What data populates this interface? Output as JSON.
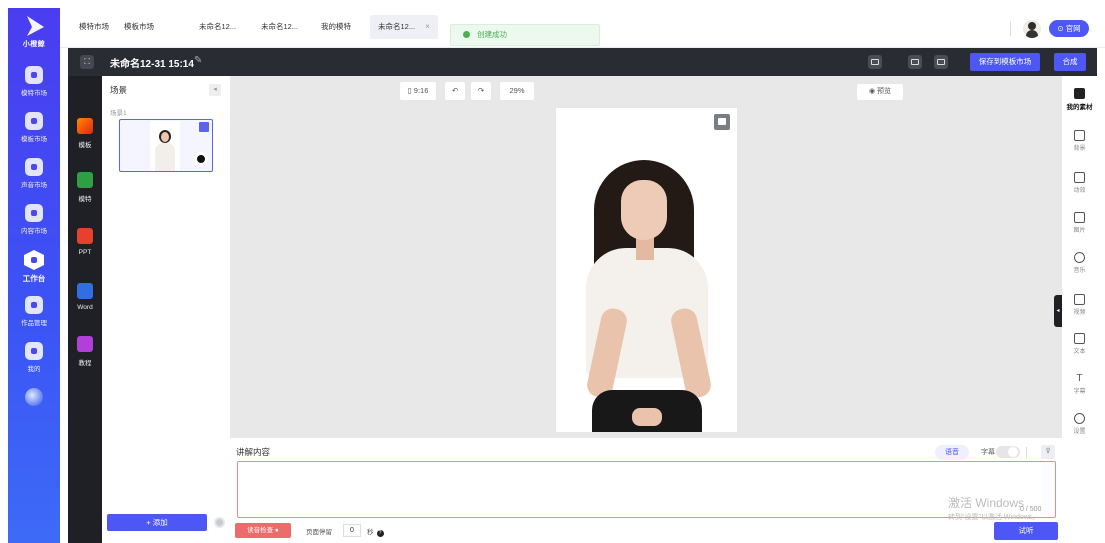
{
  "rail": {
    "logo": "小橙鲸",
    "items": [
      {
        "label": "模特市场",
        "icon": "model-market-icon"
      },
      {
        "label": "模板市场",
        "icon": "template-market-icon"
      },
      {
        "label": "声音市场",
        "icon": "voice-market-icon"
      },
      {
        "label": "内容市场",
        "icon": "content-market-icon"
      },
      {
        "label": "工作台",
        "icon": "workbench-icon"
      },
      {
        "label": "作品管理",
        "icon": "works-icon"
      },
      {
        "label": "我的",
        "icon": "user-icon"
      }
    ]
  },
  "tabs": [
    "模特市场",
    "模板市场",
    "未命名12...",
    "未命名12...",
    "我的模特",
    "未命名12..."
  ],
  "toast": "创建成功",
  "site_button": "官网",
  "editor": {
    "title": "未命名12-31 15:14",
    "save_to_market": "保存到模板市场",
    "compose": "合成"
  },
  "tools": [
    "模板",
    "模特",
    "PPT",
    "Word",
    "教程"
  ],
  "scene": {
    "header": "场景",
    "item_label": "场景1",
    "add": "+ 添加"
  },
  "canvas": {
    "ratio": "9:16",
    "zoom": "29%",
    "preview": "预览"
  },
  "right_tools": [
    "我的素材",
    "背景",
    "动效",
    "图片",
    "音乐",
    "视频",
    "文本",
    "字幕",
    "设置"
  ],
  "narration": {
    "label": "讲解内容",
    "voice": "语音",
    "subtitle": "字幕",
    "count": "0 / 500",
    "check": "读音检查",
    "pause_label": "页面停留",
    "pause_value": "0",
    "pause_unit": "秒",
    "listen": "试听"
  },
  "watermark": {
    "line1": "激活 Windows",
    "line2": "转到\"设置\"以激活 Windows。"
  }
}
